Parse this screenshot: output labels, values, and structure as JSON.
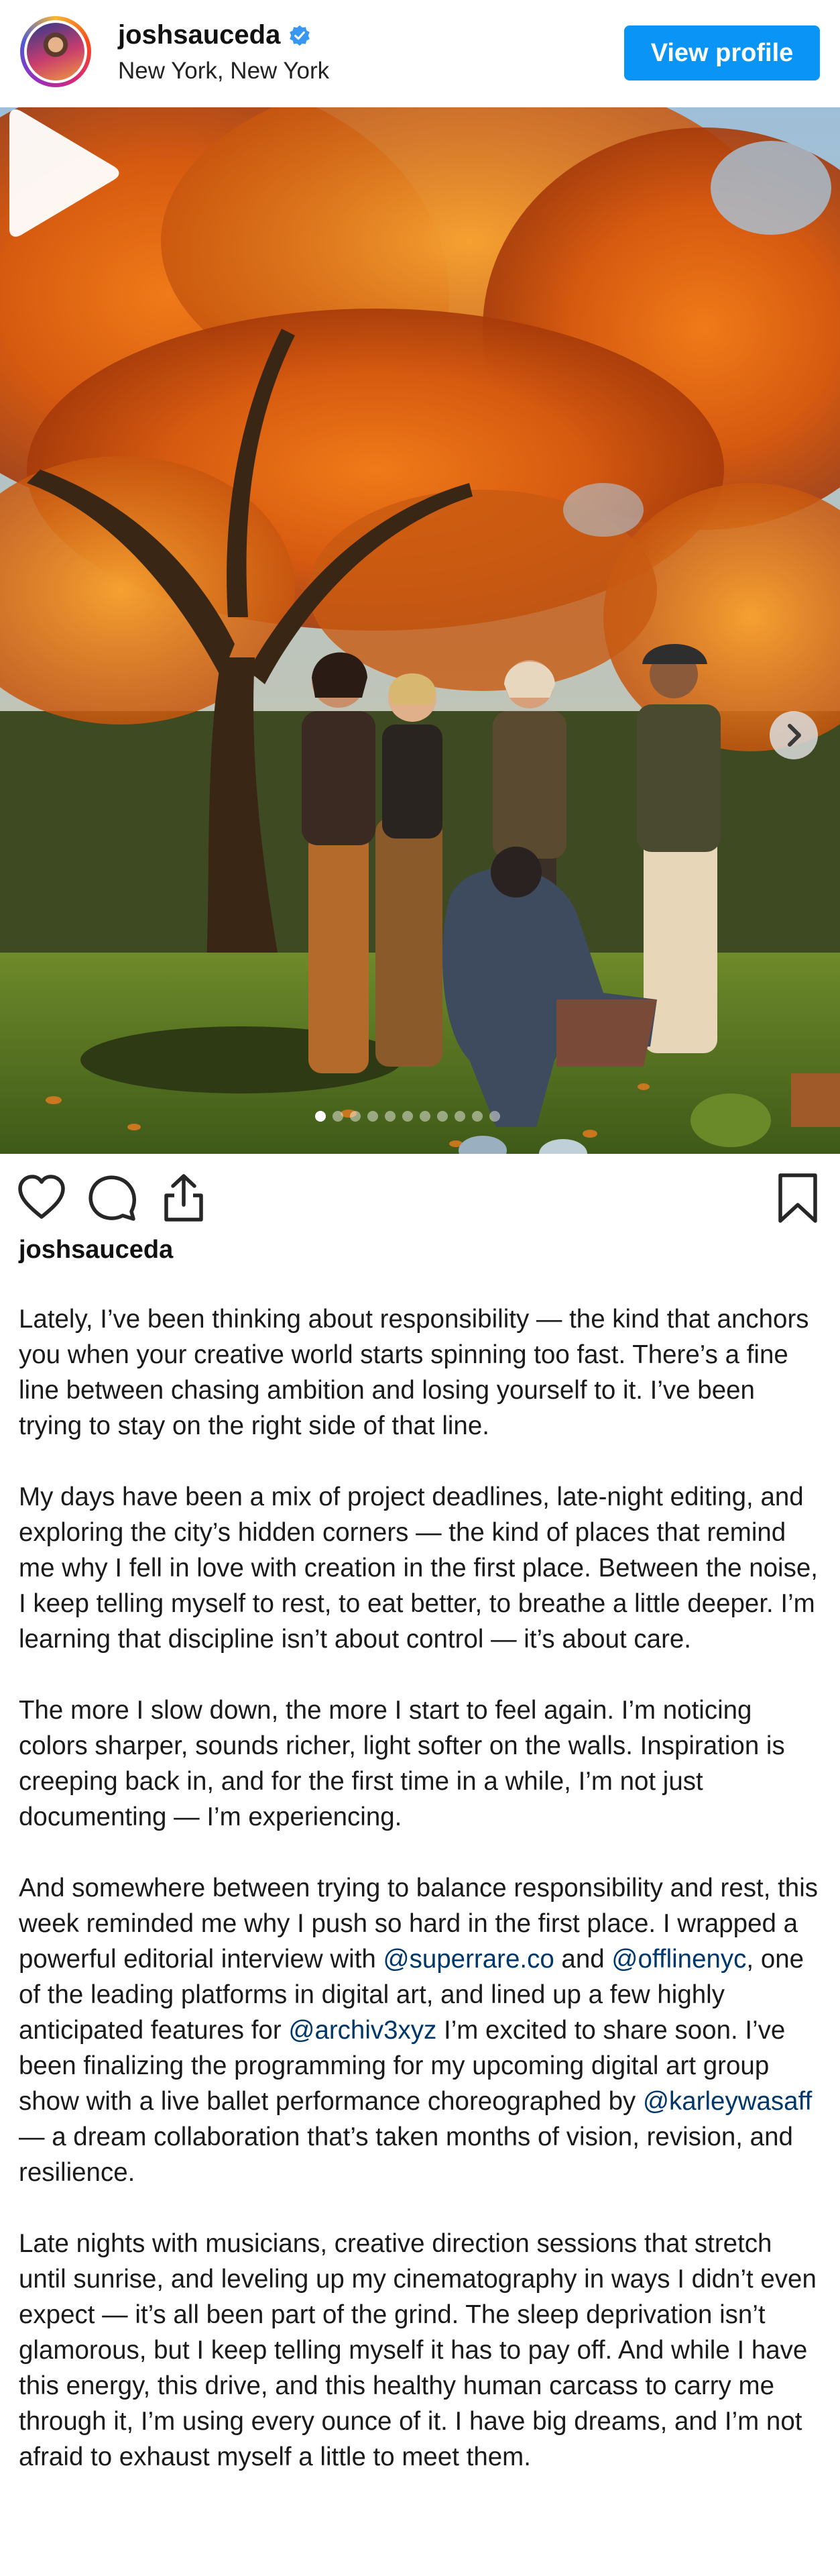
{
  "header": {
    "username": "joshsauceda",
    "location": "New York, New York",
    "view_profile_label": "View profile"
  },
  "icons": {
    "verified": "verified-badge-icon",
    "play": "play-icon",
    "next": "chevron-right-icon",
    "like": "heart-icon",
    "comment": "comment-icon",
    "share": "share-icon",
    "save": "bookmark-icon"
  },
  "colors": {
    "primary_button": "#0a95f6",
    "mention": "#00376b",
    "verified": "#3897f0"
  },
  "media": {
    "total_slides": 11,
    "active_slide": 1
  },
  "caption": {
    "username": "joshsauceda",
    "p1": "Lately, I’ve been thinking about responsibility — the kind that anchors you when your creative world starts spinning too fast. There’s a fine line between chasing ambition and losing yourself to it. I’ve been trying to stay on the right side of that line.",
    "p2": "My days have been a mix of project deadlines, late-night editing, and exploring the city’s hidden corners — the kind of places that remind me why I fell in love with creation in the first place. Between the noise, I keep telling myself to rest, to eat better, to breathe a little deeper. I’m learning that discipline isn’t about control — it’s about care.",
    "p3": "The more I slow down, the more I start to feel again. I’m noticing colors sharper, sounds richer, light softer on the walls. Inspiration is creeping back in, and for the first time in a while, I’m not just documenting — I’m experiencing.",
    "p4": {
      "t1": "And somewhere between trying to balance responsibility and rest, this week reminded me why I push so hard in the first place. I wrapped a powerful editorial interview with ",
      "m1": "@superrare.co",
      "t2": " and ",
      "m2": "@offlinenyc",
      "t3": ", one of the leading platforms in digital art, and lined up a few highly anticipated features for ",
      "m3": "@archiv3xyz",
      "t4": " I’m excited to share soon. I’ve been finalizing the programming for my upcoming digital art group show with a live ballet performance choreographed by ",
      "m4": "@karleywasaff",
      "t5": "— a dream collaboration that’s taken months of vision, revision, and resilience."
    },
    "p5": "Late nights with musicians, creative direction sessions that stretch until sunrise, and leveling up my cinematography in ways I didn’t even expect — it’s all been part of the grind. The sleep deprivation isn’t glamorous, but I keep telling myself it has to pay off. And while I have this energy, this drive, and this healthy human carcass to carry me through it, I’m using every ounce of it. I have big dreams, and I’m not afraid to exhaust myself a little to meet them."
  }
}
